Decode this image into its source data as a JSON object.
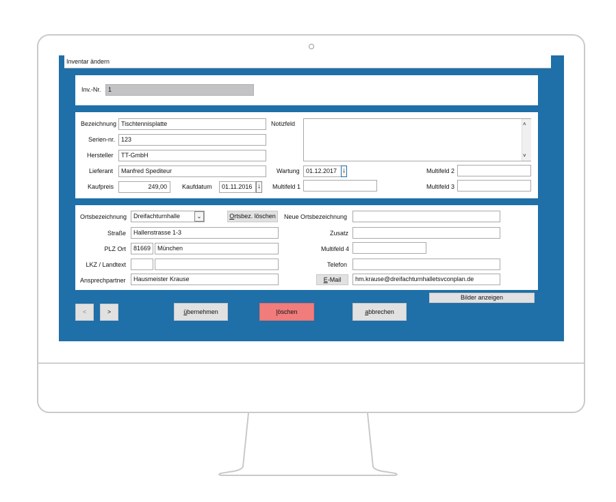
{
  "window": {
    "title": "Inventar ändern"
  },
  "inv": {
    "label": "Inv.-Nr.",
    "value": "1"
  },
  "item": {
    "bezeichnung": {
      "label": "Bezeichnung",
      "value": "Tischtennisplatte"
    },
    "serien": {
      "label": "Serien-nr.",
      "value": "123"
    },
    "hersteller": {
      "label": "Hersteller",
      "value": "TT-GmbH"
    },
    "lieferant": {
      "label": "Lieferant",
      "value": "Manfred Spediteur"
    },
    "kaufpreis": {
      "label": "Kaufpreis",
      "value": "249,00"
    },
    "kaufdatum": {
      "label": "Kaufdatum",
      "value": "01.11.2016"
    },
    "notizfeld": {
      "label": "Notizfeld",
      "value": ""
    },
    "wartung": {
      "label": "Wartung",
      "value": "01.12.2017"
    },
    "multifeld1": {
      "label": "Multifeld 1",
      "value": ""
    },
    "multifeld2": {
      "label": "Multifeld 2",
      "value": ""
    },
    "multifeld3": {
      "label": "Multifeld 3",
      "value": ""
    }
  },
  "location": {
    "ortsbezeichnung": {
      "label": "Ortsbezeichnung",
      "value": "Dreifachturnhalle"
    },
    "ortsbez_loeschen": {
      "label_u": "O",
      "label_rest": "rtsbez. löschen"
    },
    "neue_ortsbezeichnung": {
      "label": "Neue Ortsbezeichnung",
      "value": ""
    },
    "strasse": {
      "label": "Straße",
      "value": "Hallenstrasse 1-3"
    },
    "zusatz": {
      "label": "Zusatz",
      "value": ""
    },
    "plz_ort": {
      "label": "PLZ Ort",
      "plz": "81669",
      "ort": "München"
    },
    "multifeld4": {
      "label": "Multifeld 4",
      "value": ""
    },
    "lkz": {
      "label": "LKZ / Landtext",
      "lkz": "",
      "landtext": ""
    },
    "telefon": {
      "label": "Telefon",
      "value": ""
    },
    "ansprechpartner": {
      "label": "Ansprechpartner",
      "value": "Hausmeister Krause"
    },
    "email": {
      "label_u": "E",
      "label_rest": "-Mail",
      "value": "hm.krause@dreifachturnhalletsvconplan.de"
    }
  },
  "actions": {
    "prev": "<",
    "next": ">",
    "uebernehmen": {
      "u": "ü",
      "rest": "bernehmen"
    },
    "loeschen": {
      "u": "l",
      "rest": "öschen"
    },
    "abbrechen": {
      "u": "a",
      "rest": "bbrechen"
    },
    "bilder": "Bilder anzeigen"
  },
  "colors": {
    "app_bg": "#1f6fa8",
    "delete_btn": "#f07c7c",
    "inv_field": "#c3c3c6"
  }
}
